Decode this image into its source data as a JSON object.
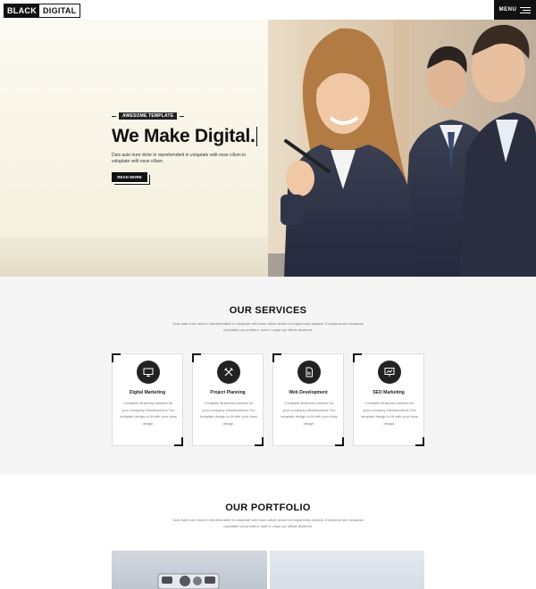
{
  "header": {
    "logo_part1": "BLACK",
    "logo_part2": "DIGITAL",
    "menu_label": "MENU"
  },
  "hero": {
    "eyebrow": "AWESOME TEMPLATE",
    "title": "We Make Digital.",
    "subtitle": "Duis aute irure dolor in reprehenderit in voluptate velit esse cillum in voluptate velit esse cillum.",
    "button_label": "READ MORE"
  },
  "services": {
    "title": "OUR SERVICES",
    "description": "Duis aute irure dolor in reprehenderit in voluptate velit esse cillum dolore eu fugiat nulla pariatur. Excepteur sint occaecat cupidatat non proident, sunt in culpa qui officia deserunt.",
    "items": [
      {
        "title": "Digital Marketing",
        "text": "Complete Business solution for your company infrastructions.The template design to fit with your ideal design.",
        "icon": "monitor-icon"
      },
      {
        "title": "Project Planning",
        "text": "Complete Business solution for your company infrastructions.The template design to fit with your ideal design.",
        "icon": "pencil-ruler-icon"
      },
      {
        "title": "Web Development",
        "text": "Complete Business solution for your company infrastructions.The template design to fit with your ideal design.",
        "icon": "document-code-icon"
      },
      {
        "title": "SEO Marketing",
        "text": "Complete Business solution for your company infrastructions.The template design to fit with your ideal design.",
        "icon": "chart-board-icon"
      }
    ]
  },
  "portfolio": {
    "title": "OUR PORTFOLIO",
    "description": "Duis aute irure dolor in reprehenderit in voluptate velit esse cillum dolore eu fugiat nulla pariatur. Excepteur sint occaecat cupidatat non proident, sunt in culpa qui officia deserunt."
  },
  "colors": {
    "accent": "#111111",
    "section_bg": "#f5f5f5",
    "hero_bg": "#f7f2e2"
  }
}
